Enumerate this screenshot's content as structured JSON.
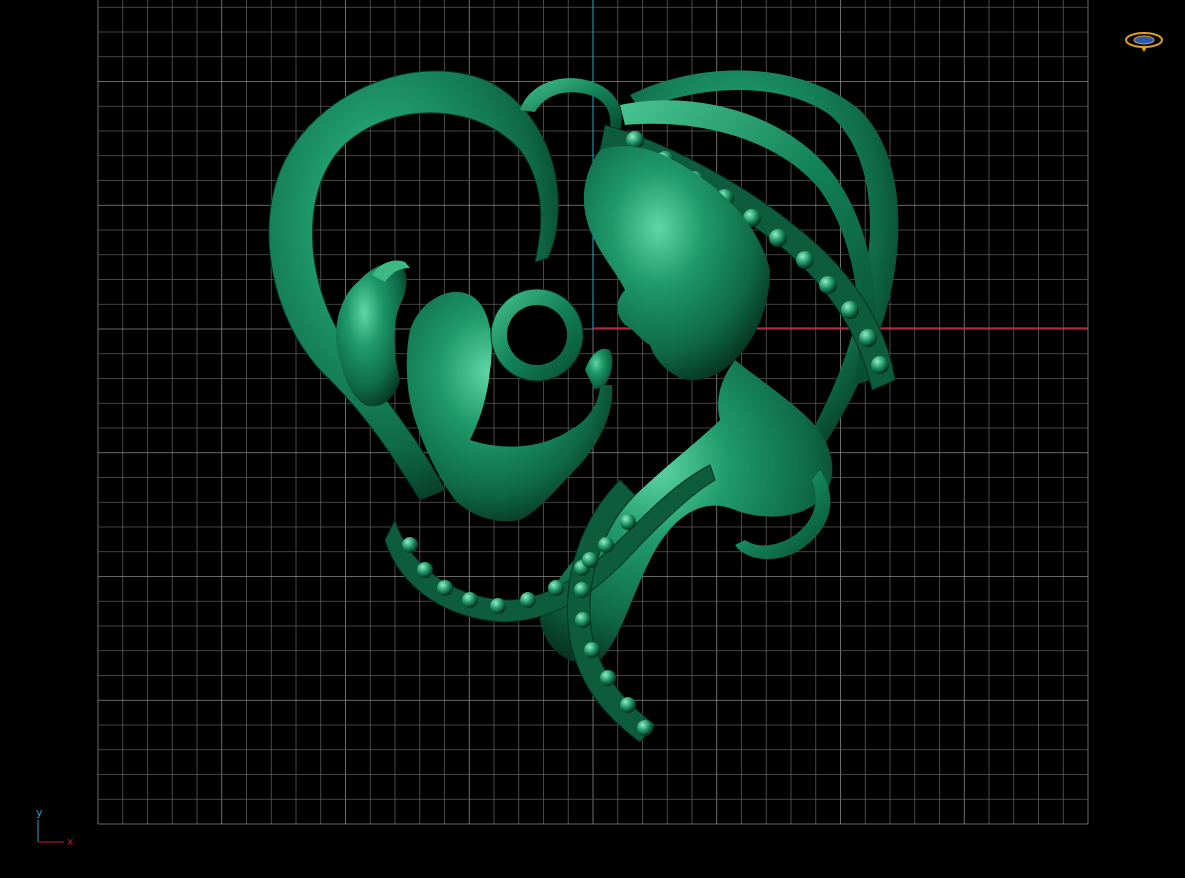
{
  "viewport": {
    "background": "#000000",
    "grid_color": "#5a5a5a",
    "grid_major_color": "#8a8a8a",
    "y_axis_color": "#2aa7c9",
    "x_axis_color": "#c0182a"
  },
  "model": {
    "description_name": "mother-and-child-heart-pendant",
    "color": "#1f8a63",
    "highlight": "#6fe0b4",
    "shadow": "#06301f"
  },
  "axis_triad": {
    "y_label": "y",
    "x_label": "x"
  },
  "icons": {
    "view_cube": "orbit-view-icon"
  }
}
